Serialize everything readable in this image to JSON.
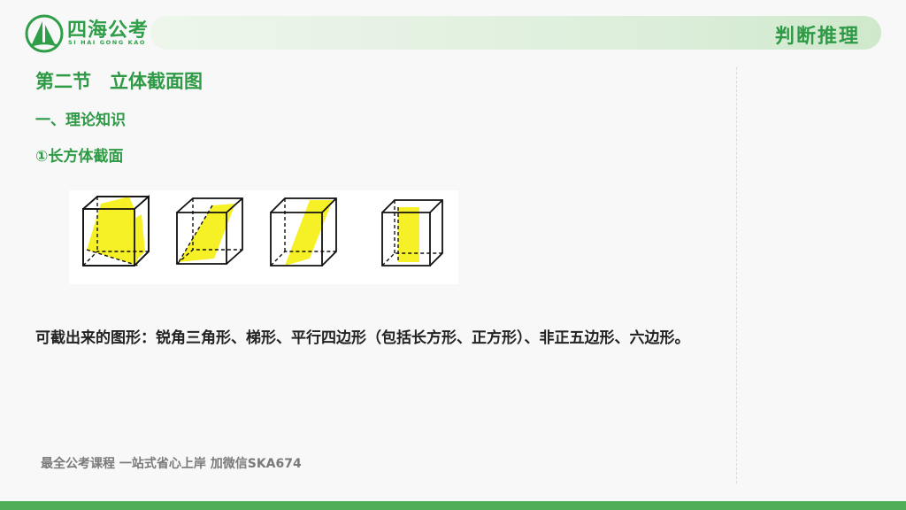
{
  "brand": {
    "name": "四海公考",
    "sub": "SI HAI GONG KAO"
  },
  "header": {
    "subject": "判断推理"
  },
  "content": {
    "section_title": "第二节　立体截面图",
    "subheading_1": "一、理论知识",
    "subheading_2": "①长方体截面",
    "description": "可截出来的图形：锐角三角形、梯形、平行四边形（包括长方形、正方形）、非正五边形、六边形。"
  },
  "footer": {
    "note": "最全公考课程 一站式省心上岸 加微信SKA674"
  },
  "colors": {
    "brand_green": "#2e9a45",
    "section_fill": "#f5ef1a"
  }
}
